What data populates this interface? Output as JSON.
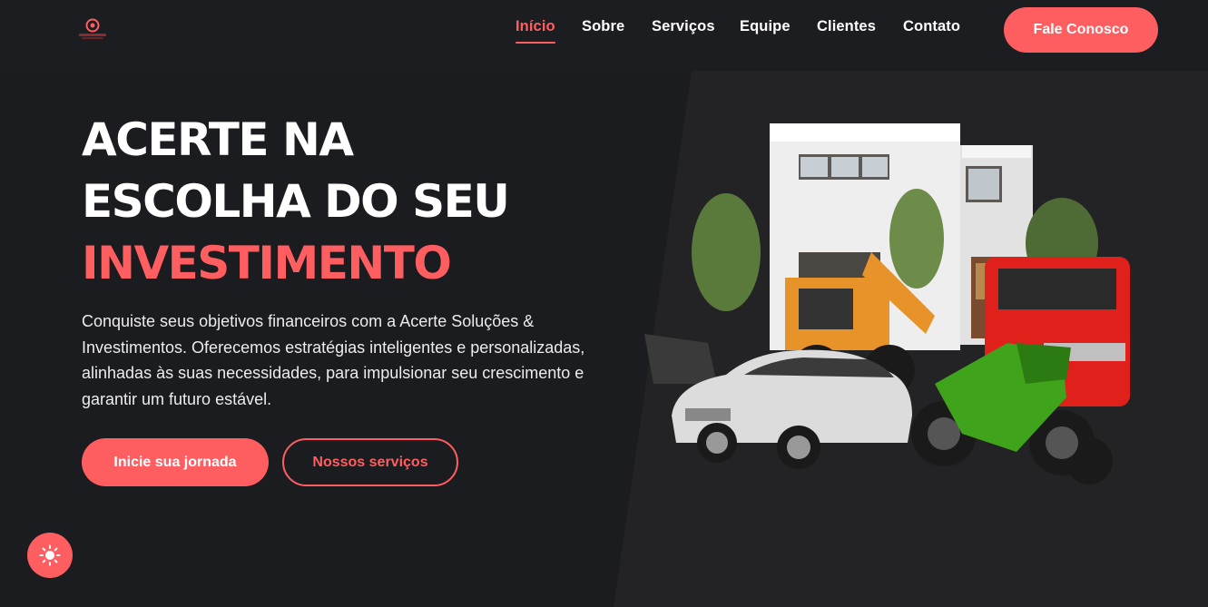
{
  "brand": {
    "logo_icon": "brand-logo-icon",
    "accent_color": "#ff5e61",
    "background_color": "#1b1c1f"
  },
  "nav": {
    "items": [
      {
        "label": "Início",
        "active": true
      },
      {
        "label": "Sobre",
        "active": false
      },
      {
        "label": "Serviços",
        "active": false
      },
      {
        "label": "Equipe",
        "active": false
      },
      {
        "label": "Clientes",
        "active": false
      },
      {
        "label": "Contato",
        "active": false
      }
    ],
    "cta_label": "Fale Conosco"
  },
  "hero": {
    "title_line1": "ACERTE NA",
    "title_line2": "ESCOLHA DO SEU",
    "title_line3": "INVESTIMENTO",
    "description": "Conquiste seus objetivos financeiros com a Acerte Soluções & Investimentos. Oferecemos estratégias inteligentes e personalizadas, alinhadas às suas necessidades, para impulsionar seu crescimento e garantir um futuro estável.",
    "primary_button": "Inicie sua jornada",
    "secondary_button": "Nossos serviços",
    "image_subjects": [
      "house",
      "backhoe-loader",
      "sedan-car",
      "red-truck",
      "motorcycle"
    ]
  },
  "theme_toggle": {
    "icon": "sun-icon"
  }
}
